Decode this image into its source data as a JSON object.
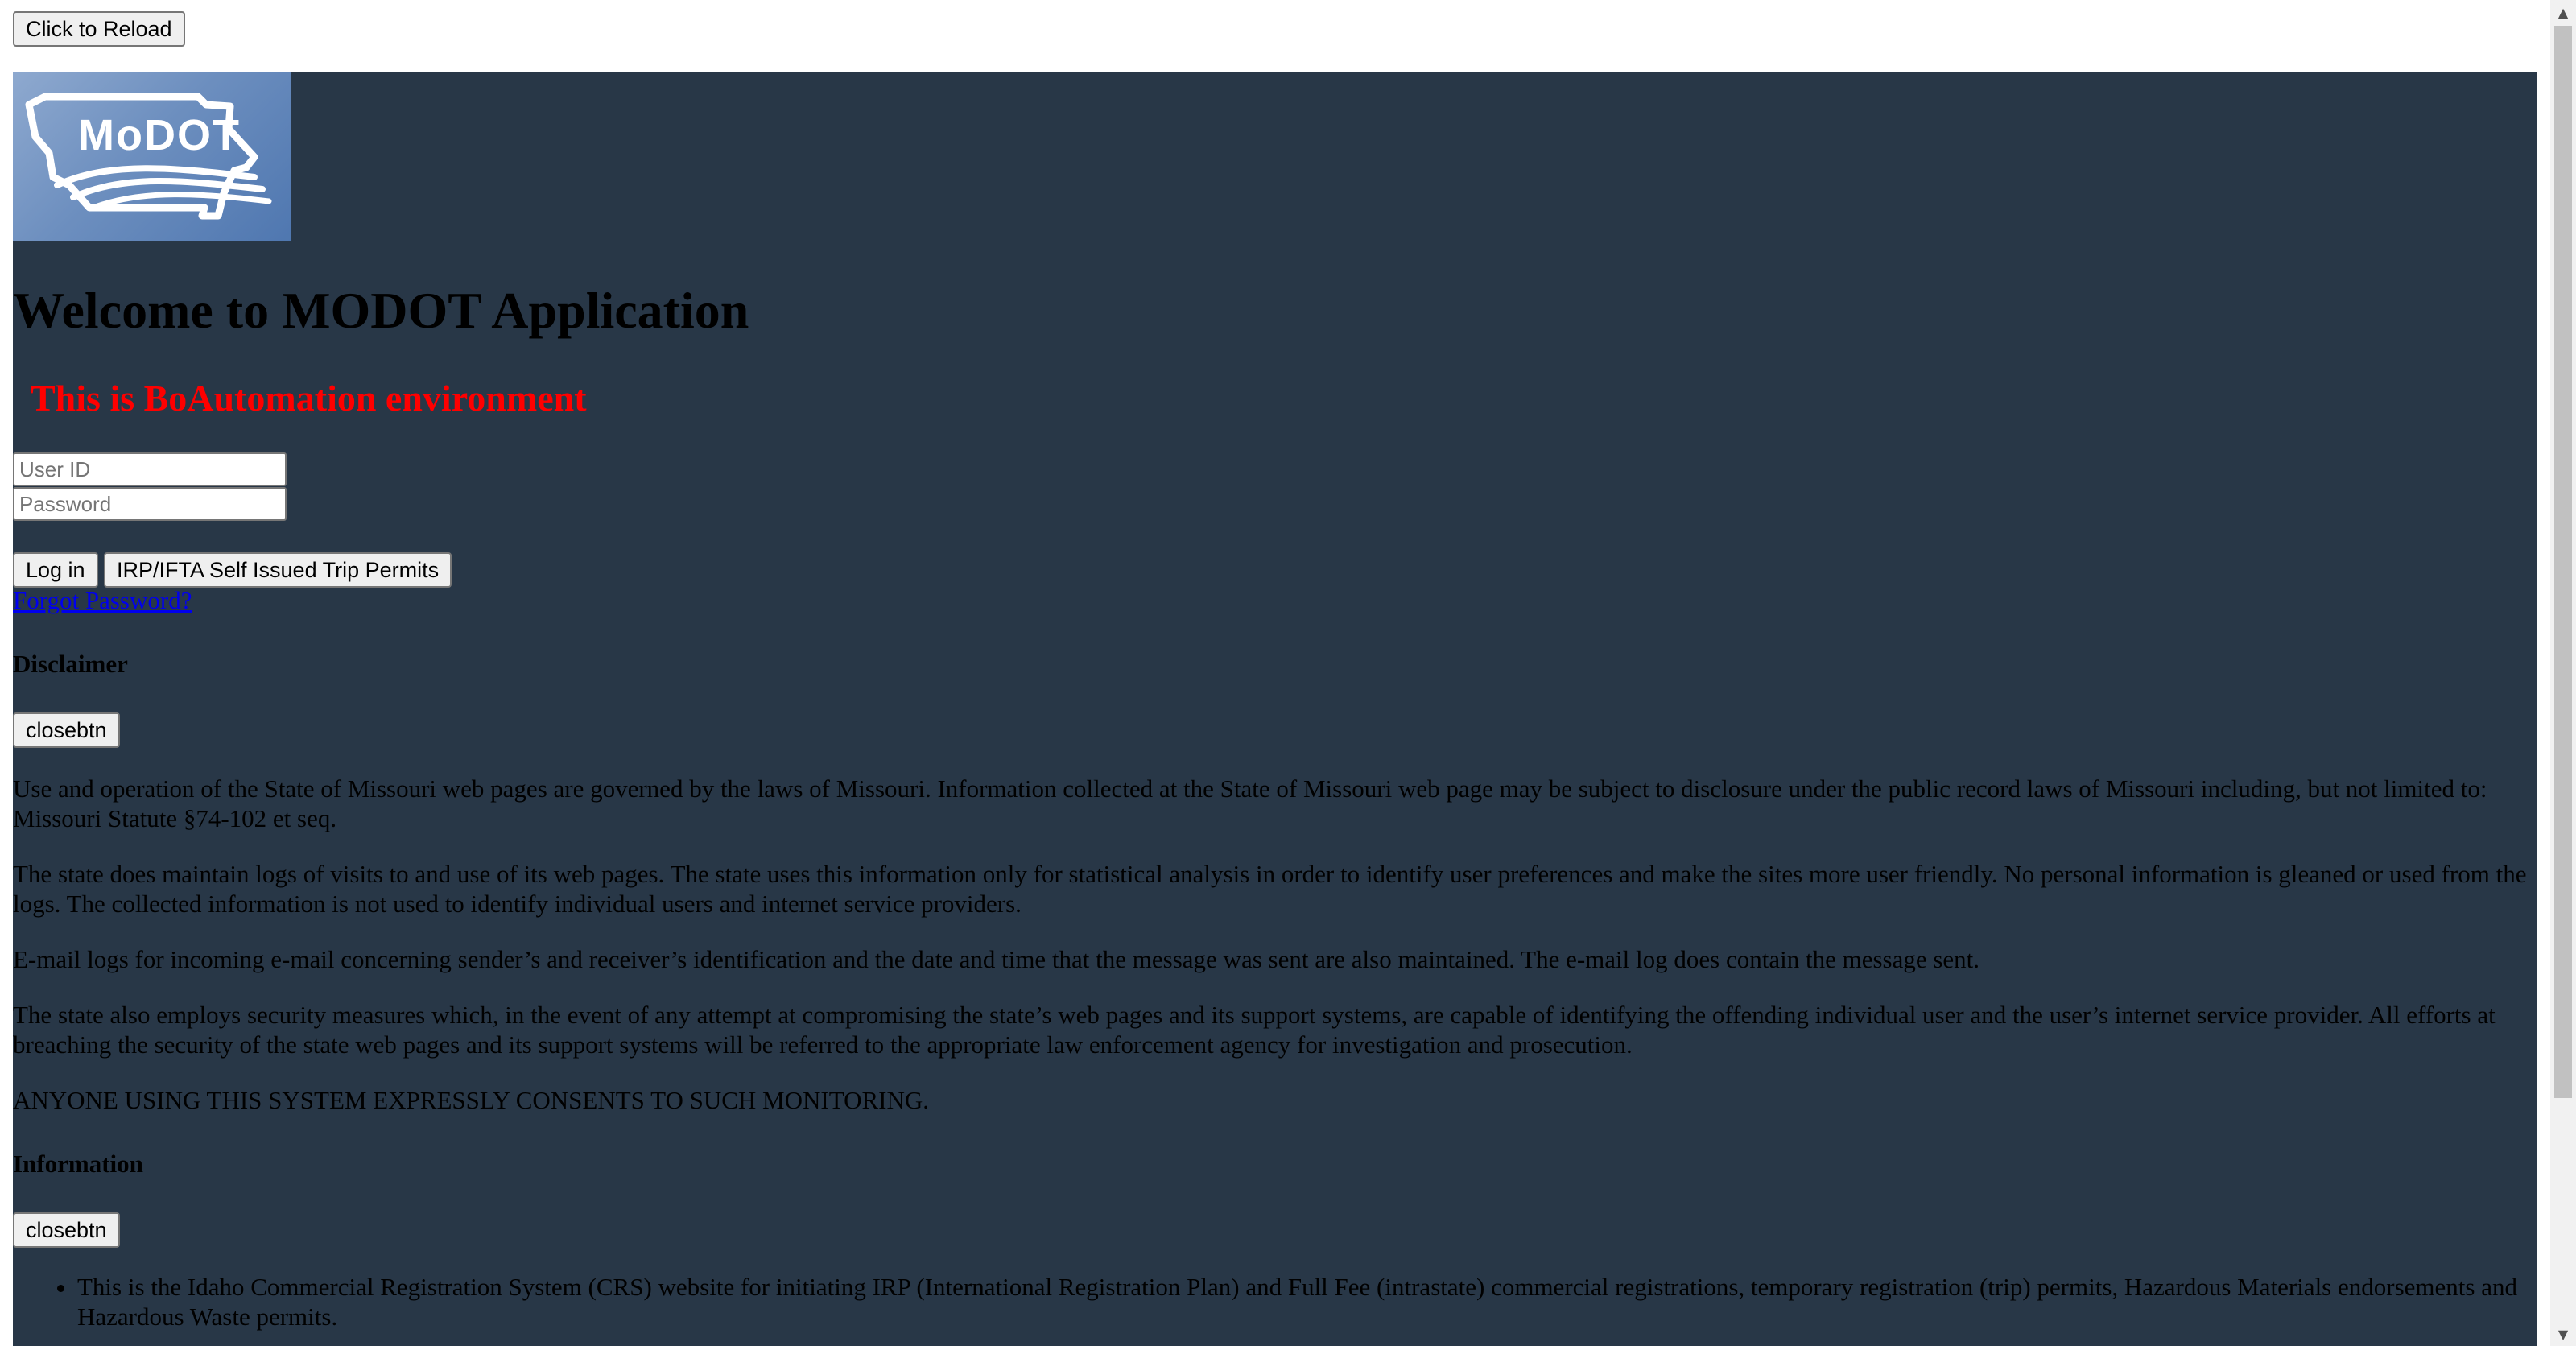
{
  "reload_label": "Click to Reload",
  "logo": {
    "text": "MoDOT"
  },
  "header": {
    "welcome": "Welcome to MODOT Application",
    "environment": "This is BoAutomation environment"
  },
  "login": {
    "userid_placeholder": "User ID",
    "password_placeholder": "Password",
    "login_label": "Log in",
    "trip_permits_label": "IRP/IFTA Self Issued Trip Permits",
    "forgot_label": "Forgot Password?"
  },
  "disclaimer": {
    "title": "Disclaimer",
    "close_label": "closebtn",
    "paragraphs": [
      "Use and operation of the State of Missouri web pages are governed by the laws of Missouri. Information collected at the State of Missouri web page may be subject to disclosure under the public record laws of Missouri including, but not limited to: Missouri Statute §74-102 et seq.",
      "The state does maintain logs of visits to and use of its web pages. The state uses this information only for statistical analysis in order to identify user preferences and make the sites more user friendly. No personal information is gleaned or used from the logs. The collected information is not used to identify individual users and internet service providers.",
      "E-mail logs for incoming e-mail concerning sender’s and receiver’s identification and the date and time that the message was sent are also maintained. The e-mail log does contain the message sent.",
      "The state also employs security measures which, in the event of any attempt at compromising the state’s web pages and its support systems, are capable of identifying the offending individual user and the user’s internet service provider. All efforts at breaching the security of the state web pages and its support systems will be referred to the appropriate law enforcement agency for investigation and prosecution.",
      "ANYONE USING THIS SYSTEM EXPRESSLY CONSENTS TO SUCH MONITORING."
    ]
  },
  "information": {
    "title": "Information",
    "close_label": "closebtn",
    "items": [
      "This is the Idaho Commercial Registration System (CRS) website for initiating IRP (International Registration Plan) and Full Fee (intrastate) commercial registrations, temporary registration (trip) permits, Hazardous Materials endorsements and Hazardous Waste permits."
    ]
  },
  "colors": {
    "panel_bg": "#283747",
    "environment_text": "#ff0000",
    "link": "#0000ee"
  }
}
